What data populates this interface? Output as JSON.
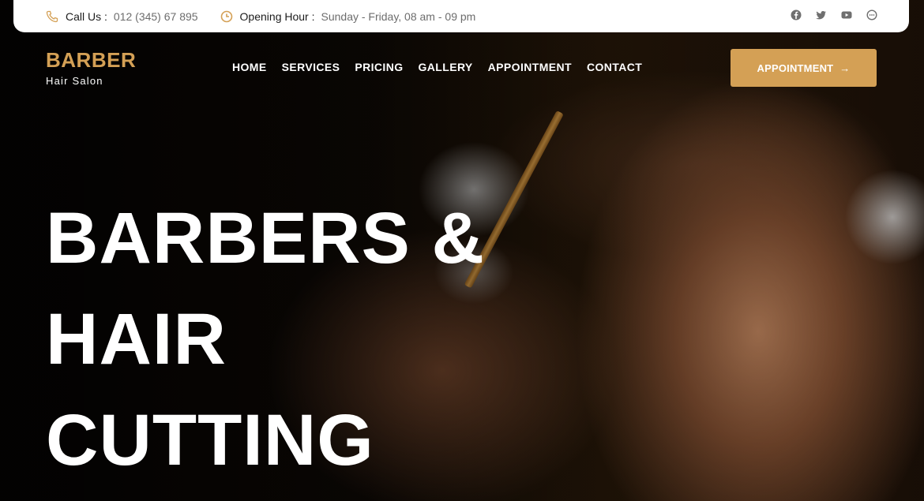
{
  "topbar": {
    "phone_label": "Call Us :",
    "phone_value": "012 (345) 67 895",
    "hours_label": "Opening Hour :",
    "hours_value": "Sunday - Friday, 08 am - 09 pm",
    "icon_color": "#d4a055",
    "social_icons": [
      "facebook-icon",
      "twitter-icon",
      "youtube-icon",
      "chat-icon"
    ]
  },
  "header": {
    "brand": "BARBER",
    "tagline": "Hair Salon",
    "brand_color": "#d4a055",
    "nav": [
      "HOME",
      "SERVICES",
      "PRICING",
      "GALLERY",
      "APPOINTMENT",
      "CONTACT"
    ],
    "cta_label": "APPOINTMENT",
    "cta_color": "#d4a055"
  },
  "hero": {
    "lines": [
      "BARBERS &",
      "HAIR",
      "CUTTING"
    ]
  }
}
